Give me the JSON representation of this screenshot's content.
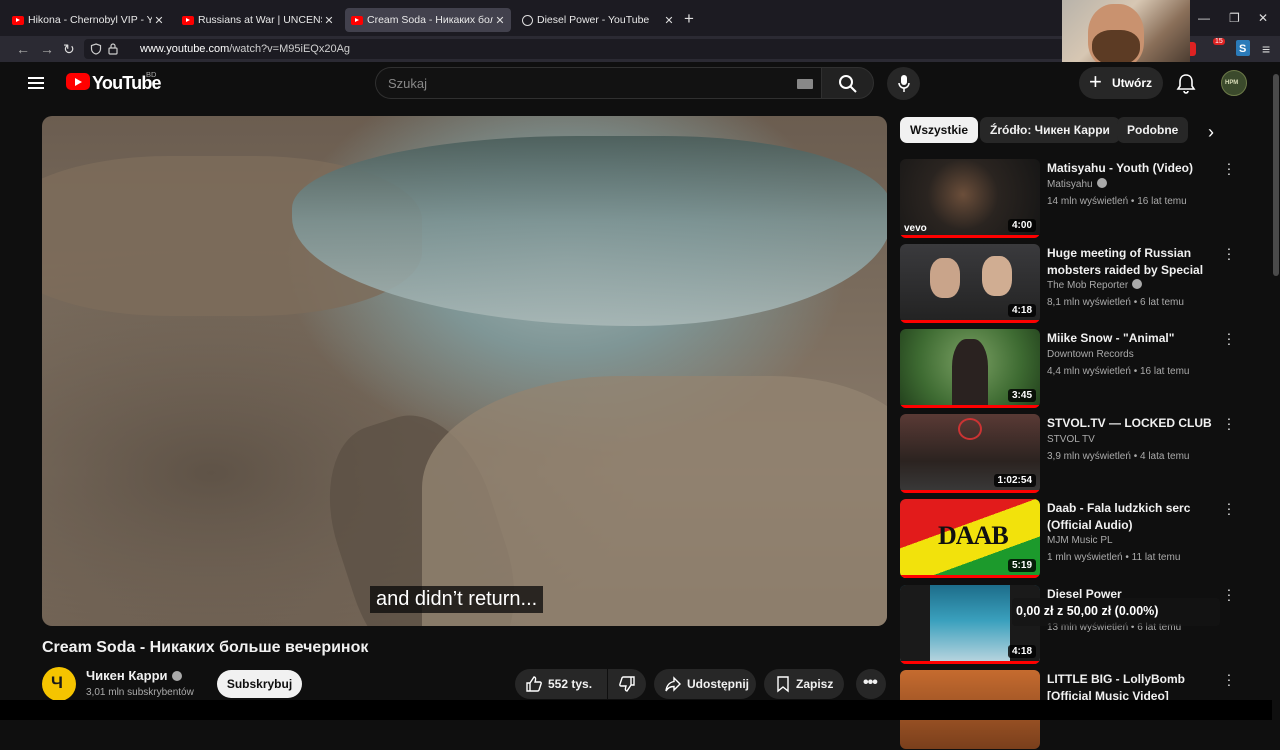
{
  "browser": {
    "tabs": [
      {
        "title": "Hikona - Chernobyl VIP - YouTube",
        "active": false,
        "icon": "youtube-icon"
      },
      {
        "title": "Russians at War | UNCENSORED",
        "active": false,
        "icon": "youtube-icon"
      },
      {
        "title": "Cream Soda - Никаких больше вечеринок",
        "active": true,
        "icon": "youtube-icon"
      },
      {
        "title": "Diesel Power - YouTube",
        "active": false,
        "icon": "globe-icon"
      }
    ],
    "url_host": "www.youtube.com",
    "url_path": "/watch?v=M95iEQx20Ag",
    "extension_badge": "15"
  },
  "header": {
    "logo_text": "YouTube",
    "country": "BD",
    "search_placeholder": "Szukaj",
    "create_label": "Utwórz",
    "avatar_text": "НРМ"
  },
  "video": {
    "subtitle": "and didn’t return...",
    "title": "Cream Soda - Никаких больше вечеринок",
    "channel": "Чикен Карри",
    "channel_initial": "Ч",
    "subscribers": "3,01 mln subskrybentów",
    "subscribe_label": "Subskrybuj",
    "likes": "552 tys.",
    "share_label": "Udostępnij",
    "save_label": "Zapisz"
  },
  "chips": [
    "Wszystkie",
    "Źródło: Чикен Карри",
    "Podobne"
  ],
  "recommendations": [
    {
      "title": "Matisyahu - Youth (Video)",
      "channel": "Matisyahu",
      "verified": true,
      "views": "14 mln wyświetleń",
      "age": "16 lat temu",
      "duration": "4:00"
    },
    {
      "title": "Huge meeting of Russian mobsters raided by Special ...",
      "channel": "The Mob Reporter",
      "verified": true,
      "views": "8,1 mln wyświetleń",
      "age": "6 lat temu",
      "duration": "4:18"
    },
    {
      "title": "Miike Snow - \"Animal\"",
      "channel": "Downtown Records",
      "verified": false,
      "views": "4,4 mln wyświetleń",
      "age": "16 lat temu",
      "duration": "3:45"
    },
    {
      "title": "STVOL.TV — LOCKED CLUB",
      "channel": "STVOL TV",
      "verified": false,
      "views": "3,9 mln wyświetleń",
      "age": "4 lata temu",
      "duration": "1:02:54"
    },
    {
      "title": "Daab - Fala ludzkich serc (Official Audio)",
      "channel": "MJM Music PL",
      "verified": false,
      "views": "1 mln wyświetleń",
      "age": "11 lat temu",
      "duration": "5:19",
      "thumb_text": "DAAB"
    },
    {
      "title": "Diesel Power",
      "channel": "",
      "verified": false,
      "views": "13 mln wyświetleń",
      "age": "6 lat temu",
      "duration": "4:18"
    },
    {
      "title": "LITTLE BIG - LollyBomb [Official Music Video]",
      "channel": "",
      "verified": false,
      "views": "",
      "age": "",
      "duration": ""
    }
  ],
  "overlay_text": "0,00 zł z 50,00 zł (0.00%)",
  "colors": {
    "accent": "#ff0000",
    "background": "#0f0f0f",
    "chip_selected": "#f1f1f1"
  }
}
